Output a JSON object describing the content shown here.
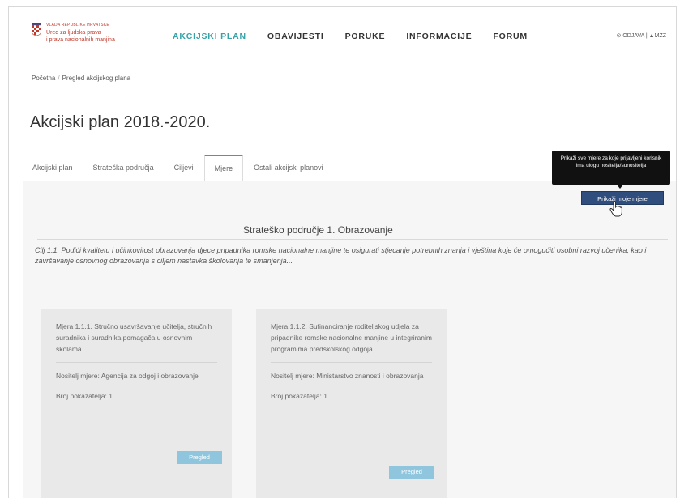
{
  "header": {
    "logo_small": "VLADA REPUBLIKE HRVATSKE",
    "logo_line1": "Ured za ljudska prava",
    "logo_line2": "i prava nacionalnih manjina",
    "nav": [
      "AKCIJSKI PLAN",
      "OBAVIJESTI",
      "PORUKE",
      "INFORMACIJE",
      "FORUM"
    ],
    "active_nav": "AKCIJSKI PLAN",
    "logout": "ODJAVA",
    "separator": "|",
    "user": "MZZ"
  },
  "breadcrumb": {
    "home": "Početna",
    "separator": "/",
    "current": "Pregled akcijskog plana"
  },
  "page_title": "Akcijski plan 2018.-2020.",
  "tabs": [
    "Akcijski plan",
    "Strateška područja",
    "Ciljevi",
    "Mjere",
    "Ostali akcijski planovi"
  ],
  "active_tab": "Mjere",
  "tooltip": "Prikaži sve mjere za koje prijavljeni korisnik ima ulogu nositelja/sunositelja",
  "my_measures_button": "Prikaži moje mjere",
  "section_title": "Strateško područje 1. Obrazovanje",
  "goal": "Cilj 1.1. Podići kvalitetu i učinkovitost obrazovanja djece pripadnika romske nacionalne manjine te osigurati stjecanje potrebnih znanja i vještina koje će omogućiti osobni razvoj učenika, kao i završavanje osnovnog obrazovanja s ciljem nastavka školovanja te smanjenja...",
  "cards": [
    {
      "title": "Mjera 1.1.1. Stručno usavršavanje učitelja, stručnih suradnika i suradnika pomagača u osnovnim školama",
      "holder": "Nositelj mjere: Agencija za odgoj i obrazovanje",
      "count": "Broj pokazatelja: 1",
      "button": "Pregled"
    },
    {
      "title": "Mjera 1.1.2. Sufinanciranje roditeljskog udjela za pripadnike romske nacionalne manjine u integriranim programima predškolskog odgoja",
      "holder": "Nositelj mjere: Ministarstvo znanosti i obrazovanja",
      "count": "Broj pokazatelja: 1",
      "button": "Pregled"
    }
  ]
}
